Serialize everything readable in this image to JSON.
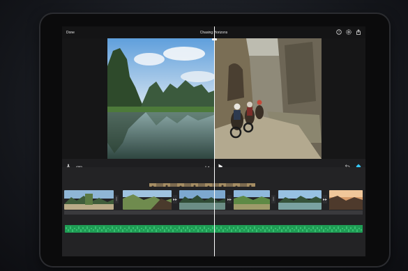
{
  "app": {
    "title": "Chasing Horizons",
    "done_label": "Done"
  },
  "icons": {
    "help": "help-icon",
    "settings": "gear-icon",
    "share": "share-icon",
    "mic": "microphone-icon",
    "camera": "camera-icon",
    "rewind": "rewind-icon",
    "play": "play-icon",
    "undo": "undo-icon",
    "add": "add-media-icon"
  },
  "colors": {
    "accent": "#35c9ff",
    "audio": "#27c26a"
  }
}
